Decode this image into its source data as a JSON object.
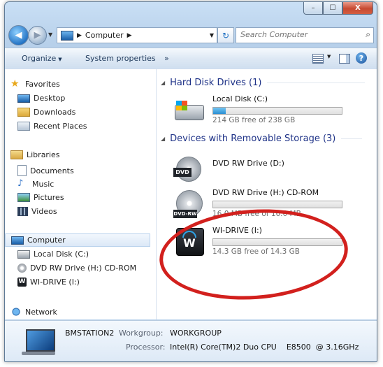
{
  "window": {
    "caption_buttons": {
      "minimize": "–",
      "maximize": "☐",
      "close": "X"
    }
  },
  "address_bar": {
    "crumbs": [
      "Computer"
    ],
    "search_placeholder": "Search Computer"
  },
  "toolbar": {
    "organize": "Organize",
    "system_properties": "System properties",
    "more": "»"
  },
  "nav": {
    "favorites": {
      "label": "Favorites",
      "items": [
        "Desktop",
        "Downloads",
        "Recent Places"
      ]
    },
    "libraries": {
      "label": "Libraries",
      "items": [
        "Documents",
        "Music",
        "Pictures",
        "Videos"
      ]
    },
    "computer": {
      "label": "Computer",
      "items": [
        "Local Disk (C:)",
        "DVD RW Drive (H:) CD-ROM",
        "WI-DRIVE (I:)"
      ]
    },
    "network": {
      "label": "Network"
    }
  },
  "content": {
    "hdd_group": {
      "title": "Hard Disk Drives (1)",
      "drives": [
        {
          "name": "Local Disk (C:)",
          "free_text": "214 GB free of 238 GB",
          "used_fraction": 0.1
        }
      ]
    },
    "removable_group": {
      "title": "Devices with Removable Storage (3)",
      "drives": [
        {
          "name": "DVD RW Drive (D:)",
          "icon_label": "DVD"
        },
        {
          "name": "DVD RW Drive (H:) CD-ROM",
          "free_text": "16.0 MB free of 16.0 MB",
          "used_fraction": 0.0,
          "icon_label": "DVD-RW"
        },
        {
          "name": "WI-DRIVE (I:)",
          "free_text": "14.3 GB free of 14.3 GB",
          "used_fraction": 0.0,
          "icon_label": "W"
        }
      ]
    }
  },
  "details": {
    "computer_name": "BMSTATION2",
    "workgroup_label": "Workgroup:",
    "workgroup": "WORKGROUP",
    "processor_label": "Processor:",
    "processor": "Intel(R) Core(TM)2 Duo CPU    E8500  @ 3.16GHz"
  },
  "colors": {
    "highlight_oval": "#d2201d",
    "group_heading": "#1e3287",
    "capacity_fill": "#2a8fd2"
  }
}
